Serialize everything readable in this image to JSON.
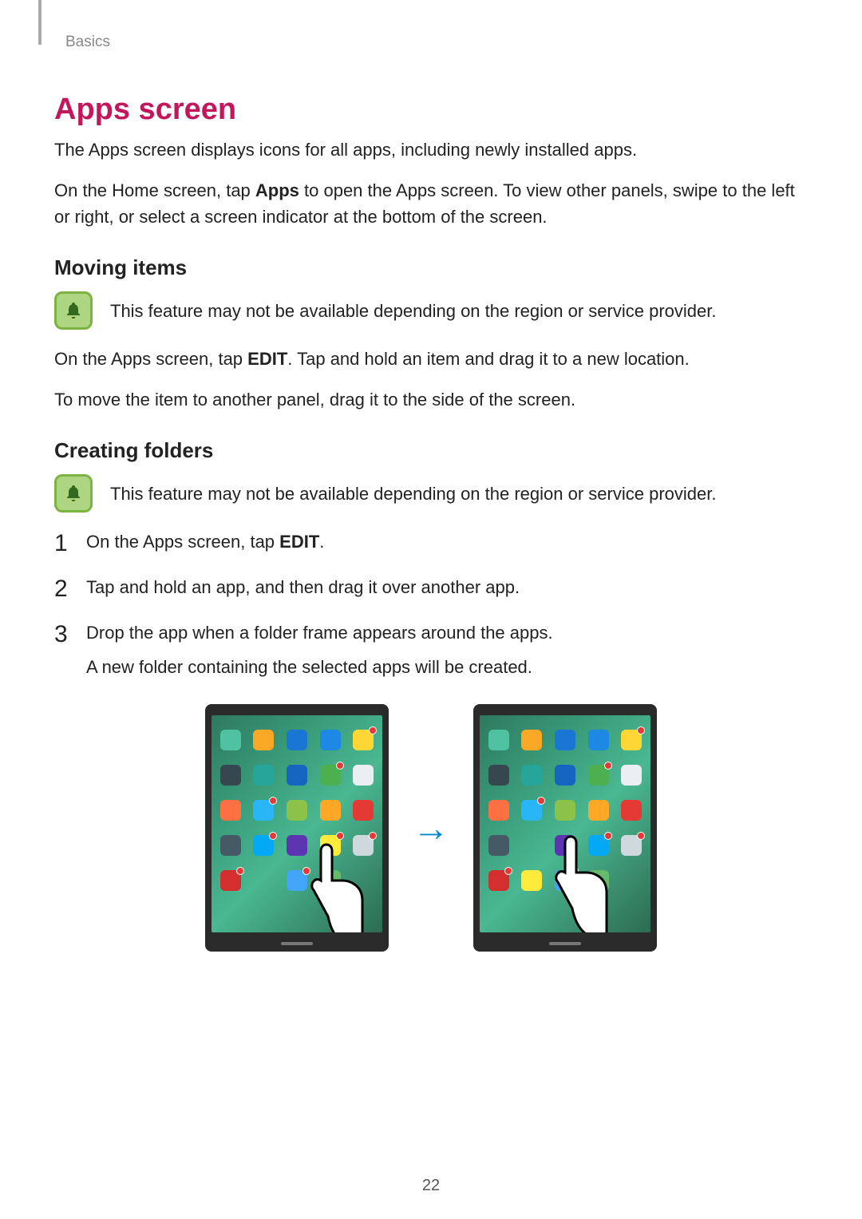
{
  "breadcrumb": "Basics",
  "title": "Apps screen",
  "intro1": "The Apps screen displays icons for all apps, including newly installed apps.",
  "intro2_pre": "On the Home screen, tap ",
  "intro2_bold": "Apps",
  "intro2_post": " to open the Apps screen. To view other panels, swipe to the left or right, or select a screen indicator at the bottom of the screen.",
  "subhead1": "Moving items",
  "note1": "This feature may not be available depending on the region or service provider.",
  "moving_p1_pre": "On the Apps screen, tap ",
  "moving_p1_bold": "EDIT",
  "moving_p1_post": ". Tap and hold an item and drag it to a new location.",
  "moving_p2": "To move the item to another panel, drag it to the side of the screen.",
  "subhead2": "Creating folders",
  "note2": "This feature may not be available depending on the region or service provider.",
  "step1_pre": "On the Apps screen, tap ",
  "step1_bold": "EDIT",
  "step1_post": ".",
  "step2": "Tap and hold an app, and then drag it over another app.",
  "step3a": "Drop the app when a folder frame appears around the apps.",
  "step3b": "A new folder containing the selected apps will be created.",
  "page_number": "22",
  "arrow": "→"
}
